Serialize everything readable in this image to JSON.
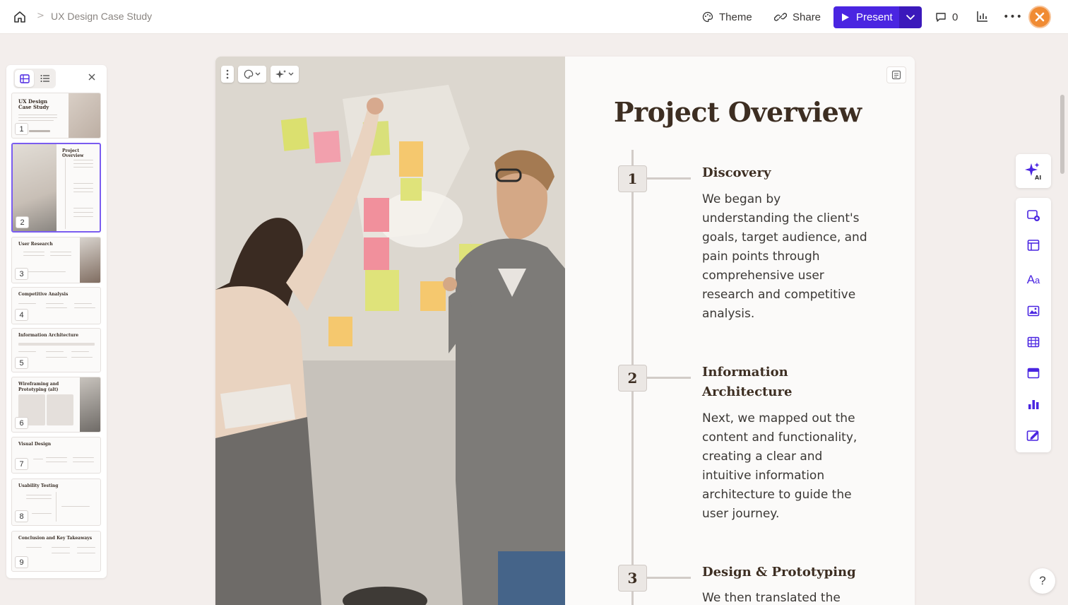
{
  "topbar": {
    "doc_title": "UX Design Case Study",
    "theme_label": "Theme",
    "share_label": "Share",
    "present_label": "Present",
    "comment_count": "0"
  },
  "sidebar": {
    "thumbnails": [
      {
        "num": "1",
        "title": "UX Design Case Study"
      },
      {
        "num": "2",
        "title": "Project Overview"
      },
      {
        "num": "3",
        "title": "User Research"
      },
      {
        "num": "4",
        "title": "Competitive Analysis"
      },
      {
        "num": "5",
        "title": "Information Architecture"
      },
      {
        "num": "6",
        "title": "Wireframing and Prototyping (alt)"
      },
      {
        "num": "7",
        "title": "Visual Design"
      },
      {
        "num": "8",
        "title": "Usability Testing"
      },
      {
        "num": "9",
        "title": "Conclusion and Key Takeaways"
      }
    ]
  },
  "slide": {
    "title": "Project Overview",
    "steps": [
      {
        "num": "1",
        "title": "Discovery",
        "body": "We began by understanding the client's goals, target audience, and pain points through comprehensive user research and competitive analysis."
      },
      {
        "num": "2",
        "title": "Information Architecture",
        "body": "Next, we mapped out the content and functionality, creating a clear and intuitive information architecture to guide the user journey."
      },
      {
        "num": "3",
        "title": "Design & Prototyping",
        "body": "We then translated the"
      }
    ]
  },
  "help": {
    "label": "?"
  },
  "colors": {
    "accent": "#4a25e1",
    "accent_dark": "#3b19bb",
    "avatar": "#f08b33",
    "heading": "#3d2e22"
  },
  "icons": [
    "home-icon",
    "palette-icon",
    "link-icon",
    "play-icon",
    "chevron-down-icon",
    "comment-icon",
    "analytics-icon",
    "more-icon",
    "grid-view-icon",
    "list-view-icon",
    "close-icon",
    "ai-sparkle-icon",
    "notes-icon"
  ]
}
